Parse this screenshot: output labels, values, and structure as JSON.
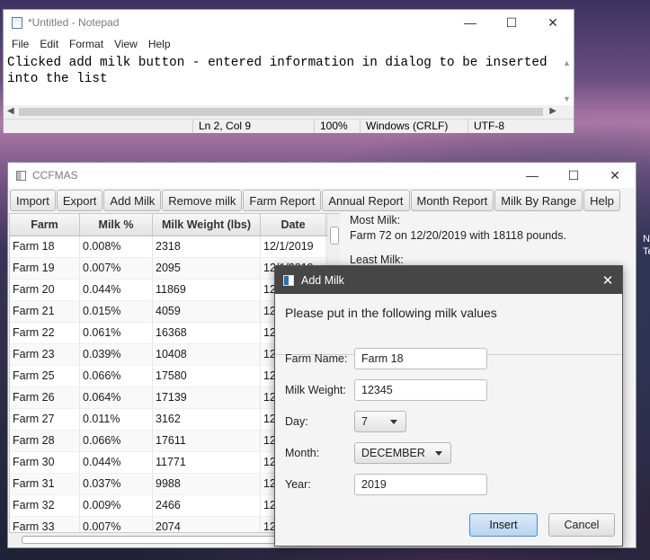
{
  "notepad": {
    "title": "*Untitled - Notepad",
    "menu": [
      "File",
      "Edit",
      "Format",
      "View",
      "Help"
    ],
    "content": "Clicked add milk button - entered information in dialog to be inserted into the list",
    "status": {
      "position": "Ln 2, Col 9",
      "zoom": "100%",
      "line_ending": "Windows (CRLF)",
      "encoding": "UTF-8"
    }
  },
  "window_controls": {
    "minimize": "—",
    "maximize": "☐",
    "close": "✕"
  },
  "ccfmas": {
    "title": "CCFMAS",
    "toolbar": [
      "Import",
      "Export",
      "Add Milk",
      "Remove milk",
      "Farm Report",
      "Annual Report",
      "Month Report",
      "Milk By Range",
      "Help"
    ],
    "columns": [
      "Farm",
      "Milk %",
      "Milk Weight (lbs)",
      "Date"
    ],
    "rows": [
      [
        "Farm 18",
        "0.008%",
        "2318",
        "12/1/2019"
      ],
      [
        "Farm 19",
        "0.007%",
        "2095",
        "12/1/2019"
      ],
      [
        "Farm 20",
        "0.044%",
        "11869",
        "12"
      ],
      [
        "Farm 21",
        "0.015%",
        "4059",
        "12"
      ],
      [
        "Farm 22",
        "0.061%",
        "16368",
        "12"
      ],
      [
        "Farm 23",
        "0.039%",
        "10408",
        "12"
      ],
      [
        "Farm 25",
        "0.066%",
        "17580",
        "12"
      ],
      [
        "Farm 26",
        "0.064%",
        "17139",
        "12"
      ],
      [
        "Farm 27",
        "0.011%",
        "3162",
        "12"
      ],
      [
        "Farm 28",
        "0.066%",
        "17611",
        "12"
      ],
      [
        "Farm 30",
        "0.044%",
        "11771",
        "12"
      ],
      [
        "Farm 31",
        "0.037%",
        "9988",
        "12"
      ],
      [
        "Farm 32",
        "0.009%",
        "2466",
        "12"
      ],
      [
        "Farm 33",
        "0.007%",
        "2074",
        "12"
      ]
    ],
    "info": {
      "most_label": "Most Milk:",
      "most_value": "Farm 72 on 12/20/2019 with 18118 pounds.",
      "least_label": "Least Milk:"
    }
  },
  "dialog": {
    "title": "Add Milk",
    "header": "Please put in the following milk values",
    "farm_label": "Farm Name:",
    "farm_value": "Farm 18",
    "weight_label": "Milk Weight:",
    "weight_value": "12345",
    "day_label": "Day:",
    "day_value": "7",
    "month_label": "Month:",
    "month_value": "DECEMBER",
    "year_label": "Year:",
    "year_value": "2019",
    "insert_label": "Insert",
    "cancel_label": "Cancel"
  },
  "desktop_edge": {
    "line1": "N",
    "line2": "Te"
  }
}
